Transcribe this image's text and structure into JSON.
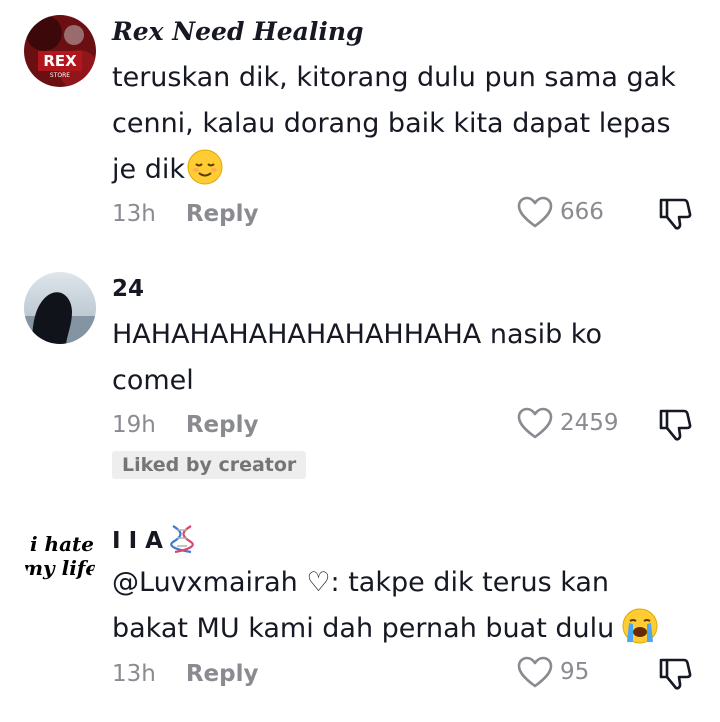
{
  "comments": [
    {
      "username": "Rex Need Healing",
      "text": "teruskan dik, kitorang dulu pun sama gak cenni, kalau dorang baik kita dapat lepas je dik",
      "emoji": "relieved-face-emoji",
      "time": "13h",
      "reply_label": "Reply",
      "likes": "666",
      "avatar_text": "REX",
      "avatar_subtext": "STORE"
    },
    {
      "username": "24",
      "text": "HAHAHAHAHAHAHAHHAHA nasib ko comel",
      "time": "19h",
      "reply_label": "Reply",
      "likes": "2459",
      "badge": "Liked by creator"
    },
    {
      "username": "I I A",
      "username_emoji": "dna-emoji",
      "text": "@Luvxmairah ♡: takpe dik terus kan bakat MU kami dah pernah buat dulu",
      "emoji": "loudly-crying-face-emoji",
      "time": "13h",
      "reply_label": "Reply",
      "likes": "95",
      "avatar_line1": "i hate",
      "avatar_line2": "my life"
    }
  ],
  "colors": {
    "text": "#161823",
    "muted": "#8a8b91",
    "badge_bg": "#eeeeef"
  },
  "icons": {
    "like": "heart-outline-icon",
    "dislike": "thumbs-down-outline-icon"
  }
}
